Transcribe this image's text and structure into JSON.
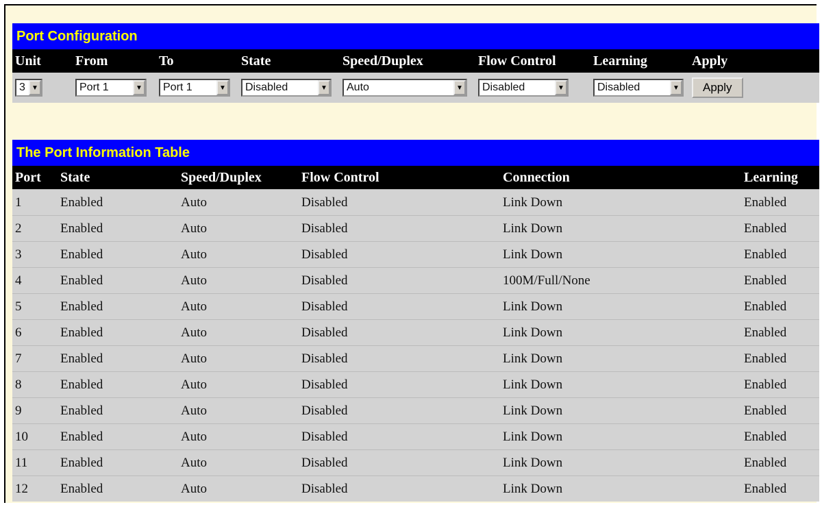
{
  "config": {
    "title": "Port Configuration",
    "headers": [
      "Unit",
      "From",
      "To",
      "State",
      "Speed/Duplex",
      "Flow Control",
      "Learning",
      "Apply"
    ],
    "unit": "3",
    "from": "Port 1",
    "to": "Port 1",
    "state": "Disabled",
    "speed_duplex": "Auto",
    "flow_control": "Disabled",
    "learning": "Disabled",
    "apply_label": "Apply"
  },
  "info": {
    "title": "The Port Information Table",
    "headers": [
      "Port",
      "State",
      "Speed/Duplex",
      "Flow Control",
      "Connection",
      "Learning"
    ],
    "rows": [
      [
        "1",
        "Enabled",
        "Auto",
        "Disabled",
        "Link Down",
        "Enabled"
      ],
      [
        "2",
        "Enabled",
        "Auto",
        "Disabled",
        "Link Down",
        "Enabled"
      ],
      [
        "3",
        "Enabled",
        "Auto",
        "Disabled",
        "Link Down",
        "Enabled"
      ],
      [
        "4",
        "Enabled",
        "Auto",
        "Disabled",
        "100M/Full/None",
        "Enabled"
      ],
      [
        "5",
        "Enabled",
        "Auto",
        "Disabled",
        "Link Down",
        "Enabled"
      ],
      [
        "6",
        "Enabled",
        "Auto",
        "Disabled",
        "Link Down",
        "Enabled"
      ],
      [
        "7",
        "Enabled",
        "Auto",
        "Disabled",
        "Link Down",
        "Enabled"
      ],
      [
        "8",
        "Enabled",
        "Auto",
        "Disabled",
        "Link Down",
        "Enabled"
      ],
      [
        "9",
        "Enabled",
        "Auto",
        "Disabled",
        "Link Down",
        "Enabled"
      ],
      [
        "10",
        "Enabled",
        "Auto",
        "Disabled",
        "Link Down",
        "Enabled"
      ],
      [
        "11",
        "Enabled",
        "Auto",
        "Disabled",
        "Link Down",
        "Enabled"
      ],
      [
        "12",
        "Enabled",
        "Auto",
        "Disabled",
        "Link Down",
        "Enabled"
      ]
    ]
  },
  "colors": {
    "title_bar": "#0000ff",
    "title_text": "#ffff00",
    "header_bg": "#000000",
    "row_bg": "#d3d3d3"
  },
  "icons": {
    "dropdown": "dropdown-arrow-icon"
  }
}
